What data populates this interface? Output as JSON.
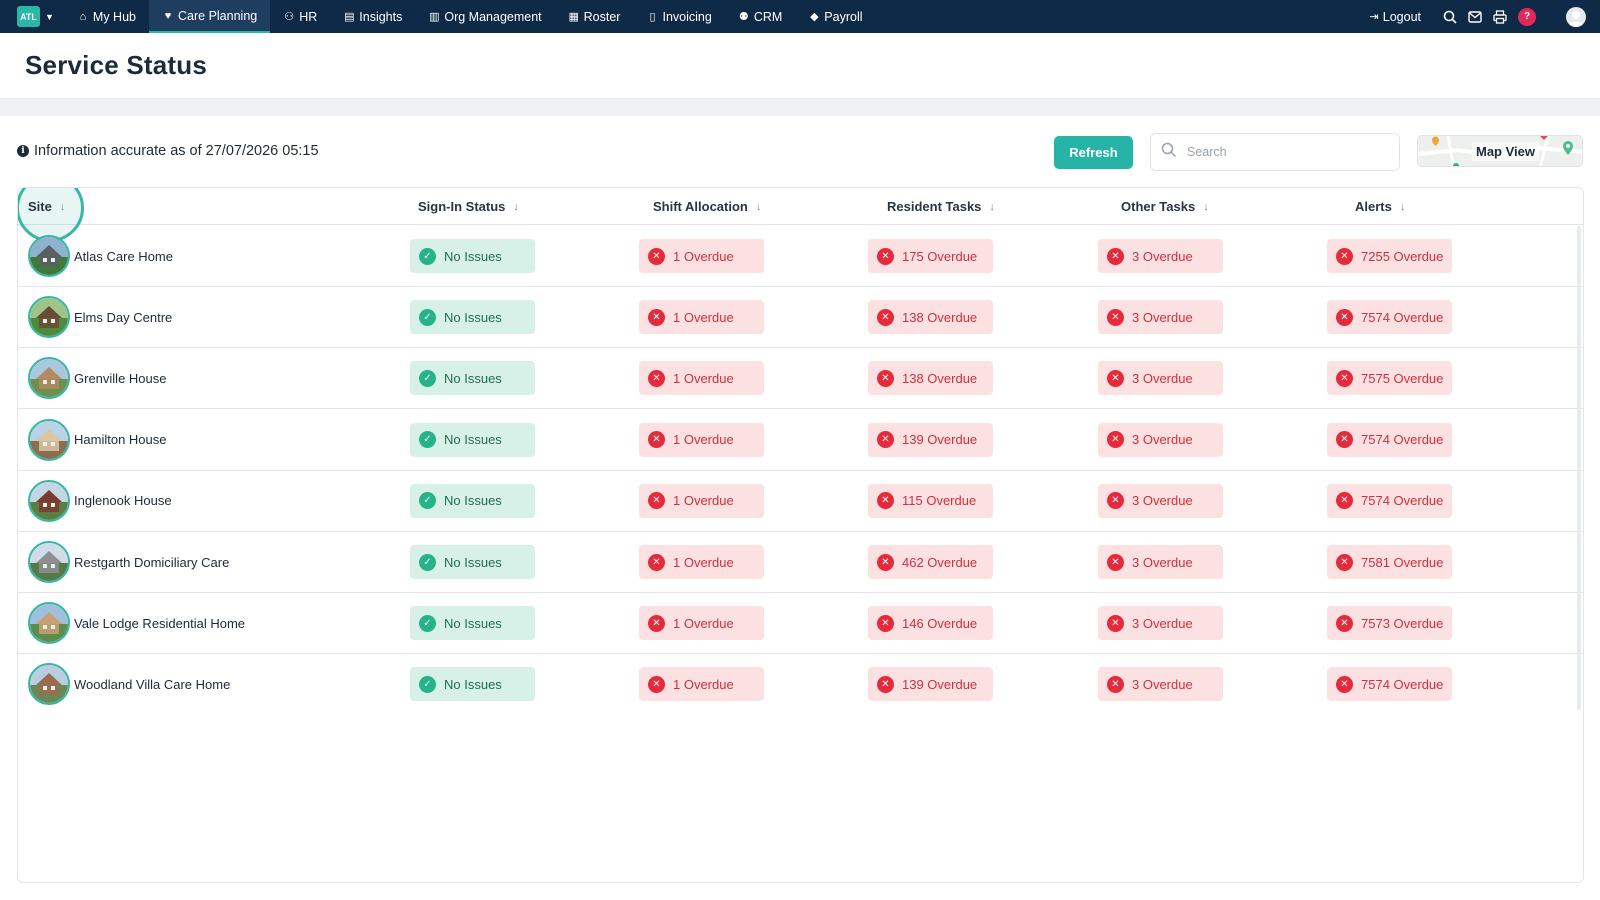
{
  "nav": {
    "brand": "ATL",
    "items": [
      {
        "label": "My Hub",
        "icon": "home-icon",
        "glyph": "⌂",
        "active": false
      },
      {
        "label": "Care Planning",
        "icon": "heart-icon",
        "glyph": "♥",
        "active": true
      },
      {
        "label": "HR",
        "icon": "people-icon",
        "glyph": "⚇",
        "active": false
      },
      {
        "label": "Insights",
        "icon": "chart-icon",
        "glyph": "▤",
        "active": false
      },
      {
        "label": "Org Management",
        "icon": "building-icon",
        "glyph": "▥",
        "active": false
      },
      {
        "label": "Roster",
        "icon": "calendar-icon",
        "glyph": "▦",
        "active": false
      },
      {
        "label": "Invoicing",
        "icon": "document-icon",
        "glyph": "▯",
        "active": false
      },
      {
        "label": "CRM",
        "icon": "contacts-icon",
        "glyph": "⚉",
        "active": false
      },
      {
        "label": "Payroll",
        "icon": "tag-icon",
        "glyph": "◆",
        "active": false
      }
    ],
    "logout_label": "Logout",
    "help_label": "?"
  },
  "page": {
    "title": "Service Status",
    "info_text": "Information accurate as of 27/07/2026 05:15",
    "refresh_label": "Refresh",
    "search_placeholder": "Search",
    "map_view_label": "Map View"
  },
  "table": {
    "columns": [
      "Site",
      "Sign-In Status",
      "Shift Allocation",
      "Resident Tasks",
      "Other Tasks",
      "Alerts"
    ],
    "rows": [
      {
        "site": "Atlas Care Home",
        "sign_in": "No Issues",
        "shift": "1 Overdue",
        "resident": "175 Overdue",
        "other": "3 Overdue",
        "alerts": "7255 Overdue"
      },
      {
        "site": "Elms Day Centre",
        "sign_in": "No Issues",
        "shift": "1 Overdue",
        "resident": "138 Overdue",
        "other": "3 Overdue",
        "alerts": "7574 Overdue"
      },
      {
        "site": "Grenville House",
        "sign_in": "No Issues",
        "shift": "1 Overdue",
        "resident": "138 Overdue",
        "other": "3 Overdue",
        "alerts": "7575 Overdue"
      },
      {
        "site": "Hamilton House",
        "sign_in": "No Issues",
        "shift": "1 Overdue",
        "resident": "139 Overdue",
        "other": "3 Overdue",
        "alerts": "7574 Overdue"
      },
      {
        "site": "Inglenook House",
        "sign_in": "No Issues",
        "shift": "1 Overdue",
        "resident": "115 Overdue",
        "other": "3 Overdue",
        "alerts": "7574 Overdue"
      },
      {
        "site": "Restgarth Domiciliary Care",
        "sign_in": "No Issues",
        "shift": "1 Overdue",
        "resident": "462 Overdue",
        "other": "3 Overdue",
        "alerts": "7581 Overdue"
      },
      {
        "site": "Vale Lodge Residential Home",
        "sign_in": "No Issues",
        "shift": "1 Overdue",
        "resident": "146 Overdue",
        "other": "3 Overdue",
        "alerts": "7573 Overdue"
      },
      {
        "site": "Woodland Villa Care Home",
        "sign_in": "No Issues",
        "shift": "1 Overdue",
        "resident": "139 Overdue",
        "other": "3 Overdue",
        "alerts": "7574 Overdue"
      }
    ]
  },
  "colors": {
    "nav_bg": "#0e2a47",
    "accent": "#26b4a6",
    "ok_bg": "#d8f1e8",
    "ok_text": "#1f6e52",
    "bad_bg": "#fbe1e2",
    "bad_text": "#d32f3c",
    "bad_icon": "#e52b3b"
  }
}
